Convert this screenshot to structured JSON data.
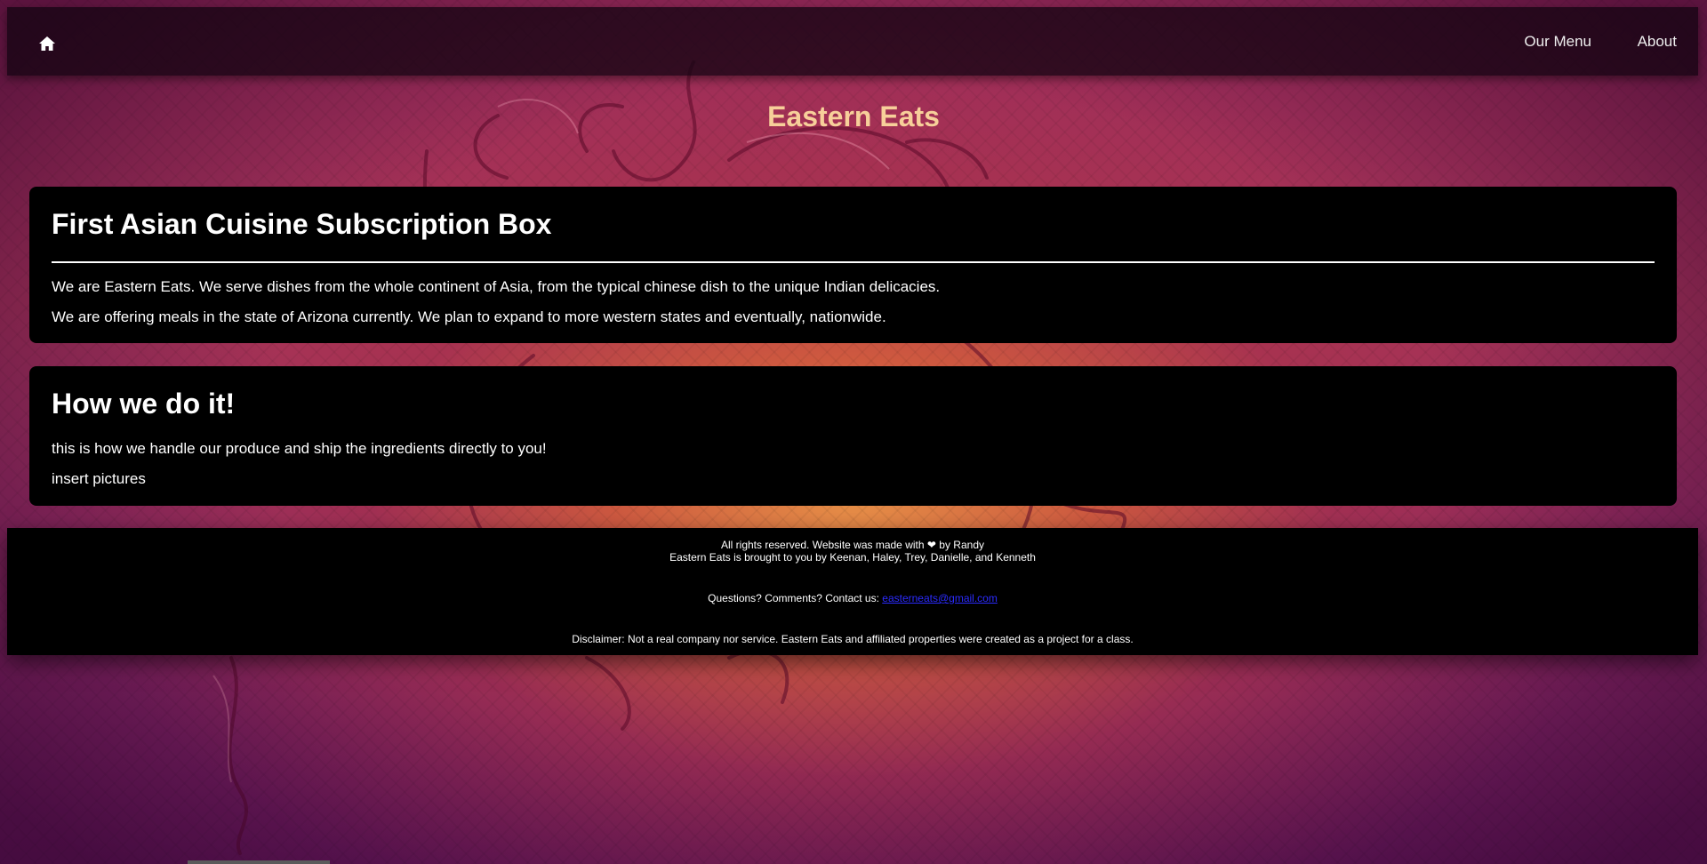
{
  "nav": {
    "home_icon": "home-icon",
    "links": [
      "Our Menu",
      "About"
    ]
  },
  "site_title": "Eastern Eats",
  "sections": [
    {
      "heading": "First Asian Cuisine Subscription Box",
      "paragraphs": [
        "We are Eastern Eats. We serve dishes from the whole continent of Asia, from the typical chinese dish to the unique Indian delicacies.",
        "We are offering meals in the state of Arizona currently. We plan to expand to more western states and eventually, nationwide."
      ]
    },
    {
      "heading": "How we do it!",
      "paragraphs": [
        "this is how we handle our produce and ship the ingredients directly to you!",
        "insert pictures"
      ]
    }
  ],
  "footer": {
    "rights_before_heart": "All rights reserved. Website was made with",
    "rights_after_heart": "by Randy",
    "credits": "Eastern Eats is brought to you by Keenan, Haley, Trey, Danielle, and Kenneth",
    "contact_label": "Questions? Comments? Contact us:",
    "contact_email": "easterneats@gmail.com",
    "disclaimer": "Disclaimer: Not a real company nor service. Eastern Eats and affiliated properties were created as a project for a class."
  },
  "colors": {
    "title": "#f7cf9a",
    "card_bg": "#000000",
    "link": "#2b2bff",
    "background_top": "#9c2c5a",
    "background_glow": "#ec9646"
  }
}
